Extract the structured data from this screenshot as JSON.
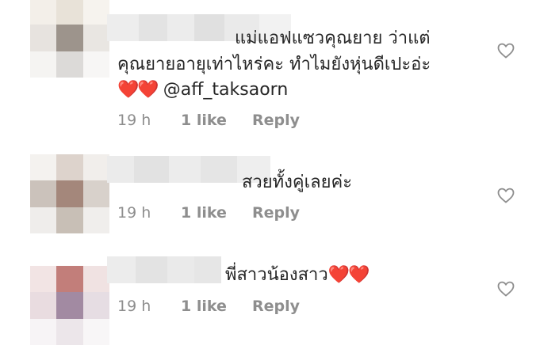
{
  "comments": [
    {
      "line1": "แม่แอฟแซวคุณยาย ว่าแต่",
      "line2": "คุณยายอายุเท่าไหร่คะ ทำไมยังหุ่นดีเปะอ่ะ",
      "line3_hearts": "❤️❤️",
      "line3_mention": "@aff_taksaorn",
      "time": "19 h",
      "likes": "1 like",
      "reply": "Reply"
    },
    {
      "line1": "สวยทั้งคู่เลยค่ะ",
      "time": "19 h",
      "likes": "1 like",
      "reply": "Reply"
    },
    {
      "line1": "พี่สาวน้องสาว",
      "line1_hearts": "❤️❤️",
      "time": "19 h",
      "likes": "1 like",
      "reply": "Reply"
    }
  ],
  "icons": {
    "like": "heart-outline-icon"
  },
  "colors": {
    "text": "#262626",
    "meta": "#8e8e8e",
    "heart": "#e02020"
  }
}
